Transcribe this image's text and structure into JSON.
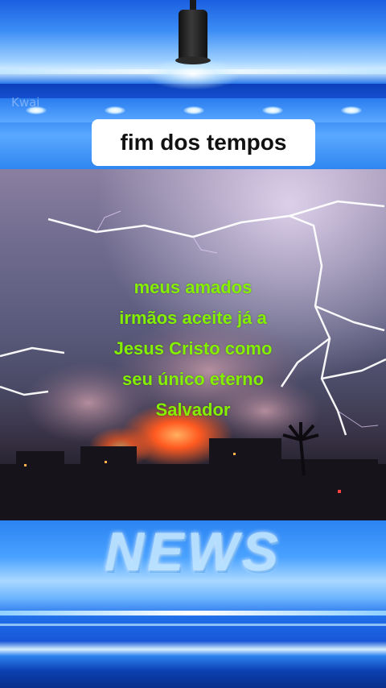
{
  "header": {
    "watermark": "Kwai",
    "title": "fim dos tempos"
  },
  "video": {
    "caption_lines": [
      "meus amados",
      "irmãos aceite já a",
      "Jesus Cristo como",
      "seu único eterno",
      "Salvador"
    ],
    "caption_color": "#84f000"
  },
  "footer": {
    "banner": "NEWS"
  },
  "icons": [
    "studio-lamp-icon"
  ],
  "colors": {
    "studio_blue": "#1e6fe8",
    "title_bg": "#ffffff"
  }
}
